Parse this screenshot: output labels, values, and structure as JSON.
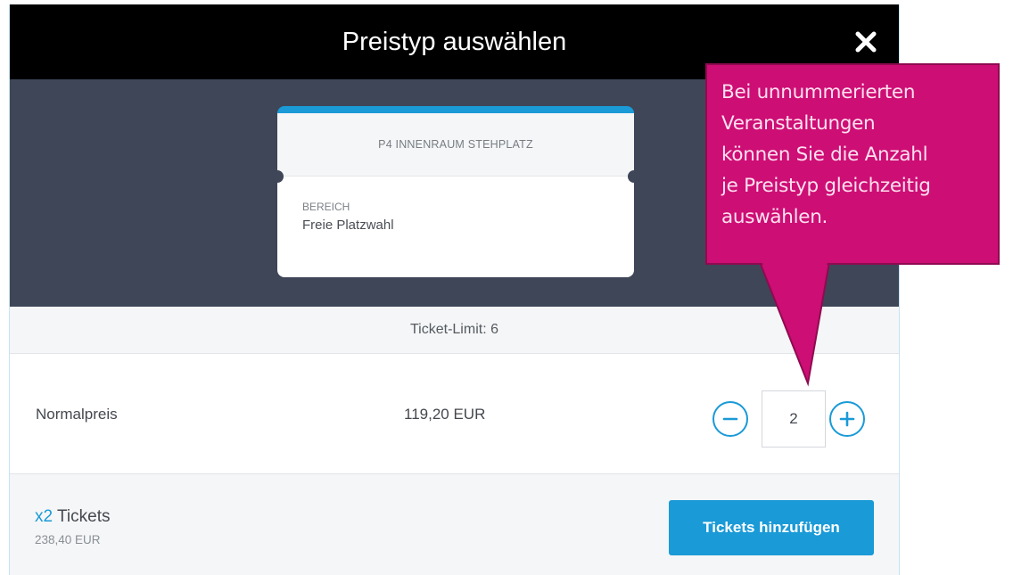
{
  "dialog": {
    "title": "Preistyp auswählen",
    "close_icon": "close-icon"
  },
  "ticket_card": {
    "section_name": "P4 INNENRAUM STEHPLATZ",
    "area_label": "BEREICH",
    "area_value": "Freie Platzwahl"
  },
  "limit": {
    "text": "Ticket-Limit: 6"
  },
  "price_row": {
    "name": "Normalpreis",
    "price": "119,20 EUR",
    "quantity": "2",
    "minus_icon": "minus-circle-icon",
    "plus_icon": "plus-circle-icon"
  },
  "footer": {
    "multiplier": "x2",
    "tickets_label": "Tickets",
    "total": "238,40 EUR",
    "add_button_label": "Tickets hinzufügen"
  },
  "callout": {
    "lines": [
      "Bei unnummerierten",
      "Veranstaltungen",
      "können Sie die Anzahl",
      "je Preistyp gleichzeitig",
      "auswählen."
    ]
  },
  "colors": {
    "accent": "#1a9ad7",
    "header_bg": "#000000",
    "hero_bg": "#3e4658",
    "callout_bg": "#cd0e75"
  }
}
